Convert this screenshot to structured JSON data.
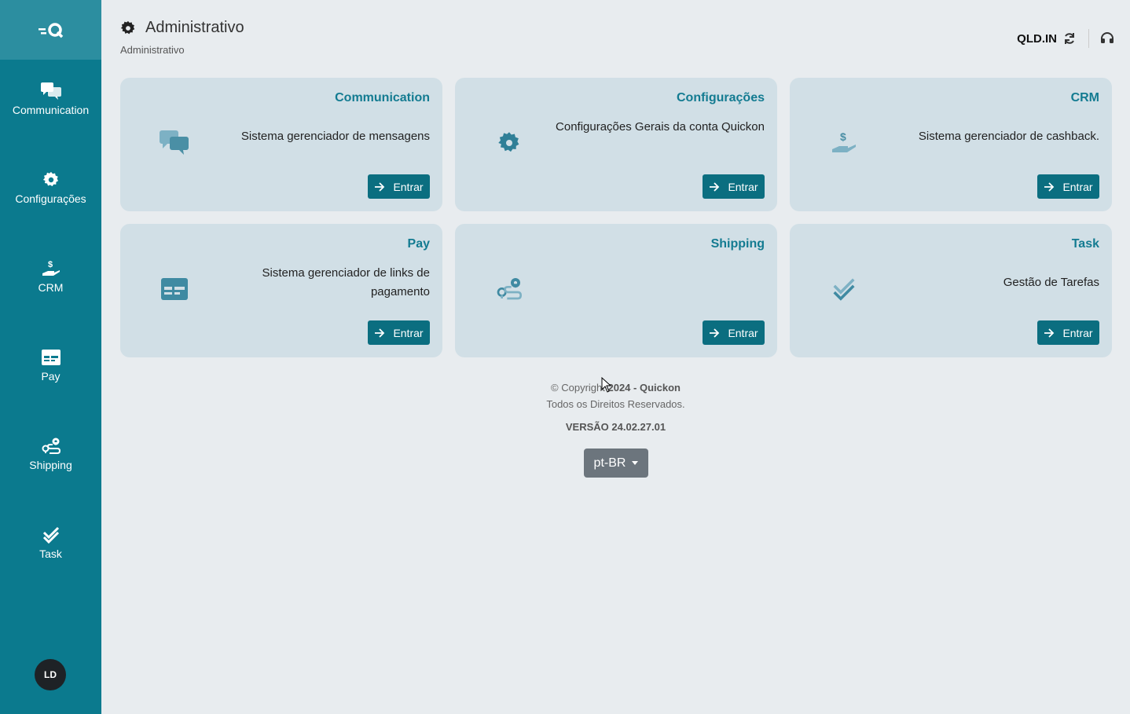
{
  "sidebar": {
    "items": [
      {
        "label": "Communication",
        "icon": "chat-icon"
      },
      {
        "label": "Configurações",
        "icon": "gear-icon"
      },
      {
        "label": "CRM",
        "icon": "hand-dollar-icon"
      },
      {
        "label": "Pay",
        "icon": "card-icon"
      },
      {
        "label": "Shipping",
        "icon": "route-icon"
      },
      {
        "label": "Task",
        "icon": "check-icon"
      }
    ],
    "avatar_initials": "LD"
  },
  "header": {
    "title": "Administrativo",
    "breadcrumb": "Administrativo",
    "company": "QLD.IN"
  },
  "cards": [
    {
      "title": "Communication",
      "desc": "Sistema gerenciador de mensagens",
      "button": "Entrar",
      "icon": "chat-icon"
    },
    {
      "title": "Configurações",
      "desc": "Configurações Gerais da conta Quickon",
      "button": "Entrar",
      "icon": "gear-icon"
    },
    {
      "title": "CRM",
      "desc": "Sistema gerenciador de cashback.",
      "button": "Entrar",
      "icon": "hand-dollar-icon"
    },
    {
      "title": "Pay",
      "desc": "Sistema gerenciador de links de pagamento",
      "button": "Entrar",
      "icon": "card-icon"
    },
    {
      "title": "Shipping",
      "desc": "",
      "button": "Entrar",
      "icon": "route-icon"
    },
    {
      "title": "Task",
      "desc": "Gestão de Tarefas",
      "button": "Entrar",
      "icon": "check-icon"
    }
  ],
  "footer": {
    "copyright_prefix": "© Copyright",
    "copyright_bold": "2024 - Quickon",
    "rights": "Todos os Direitos Reservados.",
    "version": "VERSÃO 24.02.27.01",
    "language": "pt-BR"
  },
  "colors": {
    "sidebar": "#0b7a8e",
    "accent": "#137b91",
    "card_bg": "#d1dfe6",
    "button": "#0b6e80"
  }
}
